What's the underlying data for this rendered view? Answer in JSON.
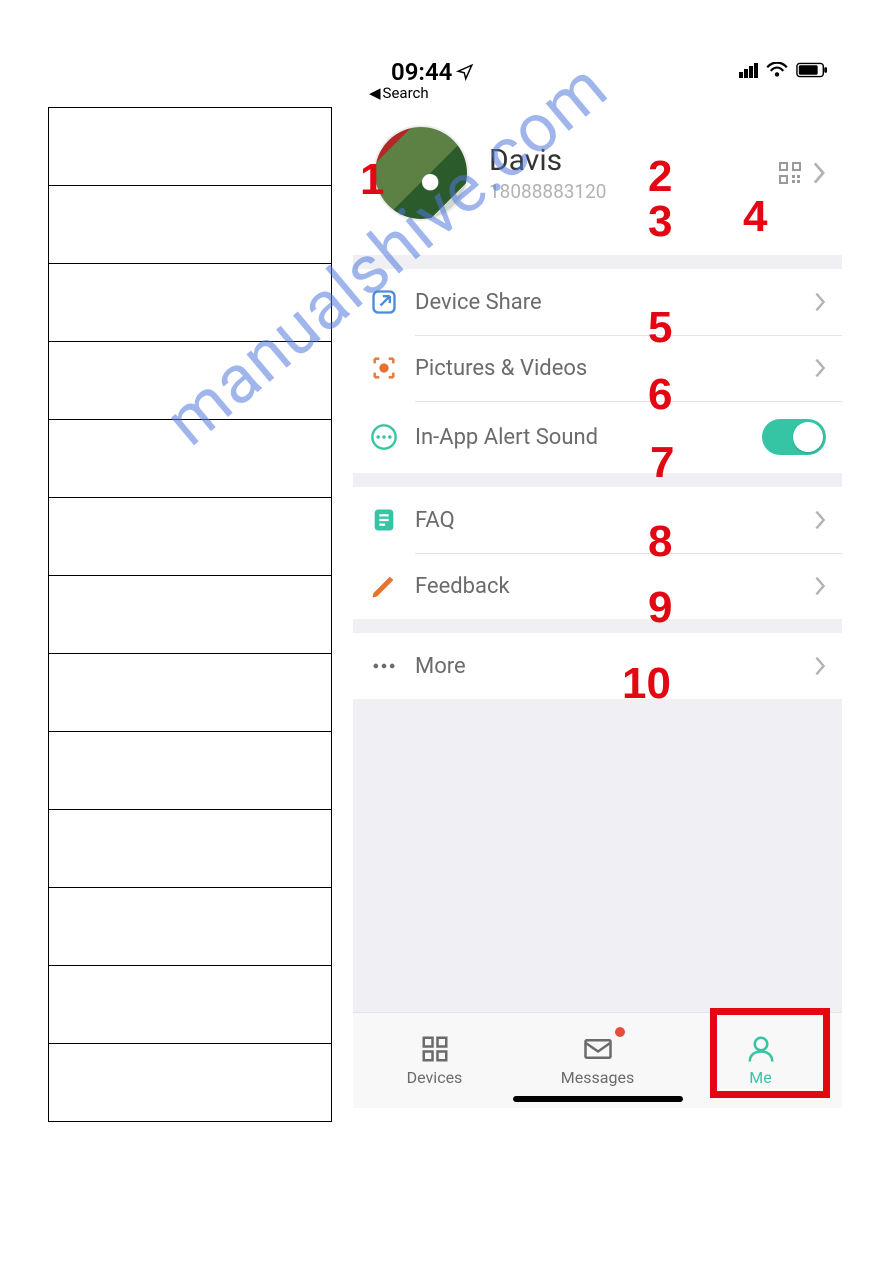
{
  "statusbar": {
    "time": "09:44",
    "back_label": "Search"
  },
  "profile": {
    "name": "Davis",
    "phone": "18088883120"
  },
  "menu": {
    "device_share": "Device Share",
    "pictures_videos": "Pictures & Videos",
    "alert_sound": "In-App Alert Sound",
    "faq": "FAQ",
    "feedback": "Feedback",
    "more": "More",
    "alert_sound_on": true
  },
  "nav": {
    "devices": "Devices",
    "messages": "Messages",
    "me": "Me",
    "messages_badge": true
  },
  "annotations": {
    "a1": "1",
    "a2": "2",
    "a3": "3",
    "a4": "4",
    "a5": "5",
    "a6": "6",
    "a7": "7",
    "a8": "8",
    "a9": "9",
    "a10": "10"
  },
  "watermark": "manualshive.com"
}
